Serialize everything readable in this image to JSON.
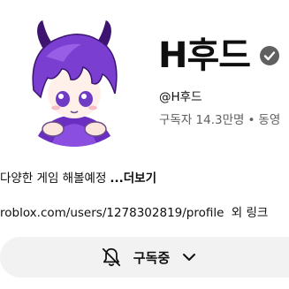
{
  "channel": {
    "name": "H후드",
    "handle": "@H후드",
    "subscribers": "구독자 14.3만명",
    "separator": "•",
    "videos_truncated": "동영",
    "verified_icon": "verified-check-icon"
  },
  "description": {
    "text": "다양한 게임 해볼예정",
    "more": "...더보기"
  },
  "links": {
    "url": "roblox.com/users/1278302819/profile",
    "more": "외 링크"
  },
  "subscribe": {
    "label": "구독중",
    "bell_icon": "bell-slash-icon",
    "chevron_icon": "chevron-down-icon"
  },
  "colors": {
    "avatar_hair": "#7a3fd1",
    "avatar_hair_dark": "#4b1c8f",
    "button_bg": "#f2f2f2",
    "secondary_text": "#606060"
  }
}
